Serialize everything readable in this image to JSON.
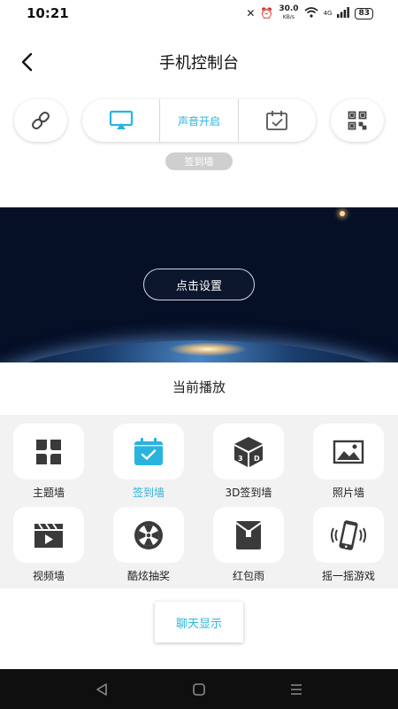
{
  "status_bar": {
    "time": "10:21",
    "net_speed": "30.0",
    "net_unit": "KB/s",
    "signal_label": "4G",
    "battery": "83"
  },
  "header": {
    "title": "手机控制台",
    "back_icon": "chevron-left-icon"
  },
  "controls": {
    "sound_label": "声音开启",
    "mode_badge": "签到墙",
    "icons": [
      "link-icon",
      "screen-cast-icon",
      "calendar-check-icon",
      "qr-code-icon"
    ],
    "accent": "#29b4df"
  },
  "banner": {
    "button_label": "点击设置"
  },
  "now_playing": {
    "label": "当前播放"
  },
  "grid": {
    "items": [
      {
        "label": "主题墙",
        "icon": "theme-grid-icon",
        "active": false
      },
      {
        "label": "签到墙",
        "icon": "checkin-calendar-icon",
        "active": true
      },
      {
        "label": "3D签到墙",
        "icon": "cube-3d-icon",
        "active": false
      },
      {
        "label": "照片墙",
        "icon": "photo-icon",
        "active": false
      },
      {
        "label": "视频墙",
        "icon": "video-clapper-icon",
        "active": false
      },
      {
        "label": "酷炫抽奖",
        "icon": "lottery-wheel-icon",
        "active": false
      },
      {
        "label": "红包雨",
        "icon": "red-envelope-icon",
        "active": false
      },
      {
        "label": "摇一摇游戏",
        "icon": "shake-phone-icon",
        "active": false
      }
    ]
  },
  "chat": {
    "label": "聊天显示"
  },
  "nav": {
    "icons": [
      "back-triangle-icon",
      "home-square-icon",
      "menu-lines-icon"
    ]
  }
}
